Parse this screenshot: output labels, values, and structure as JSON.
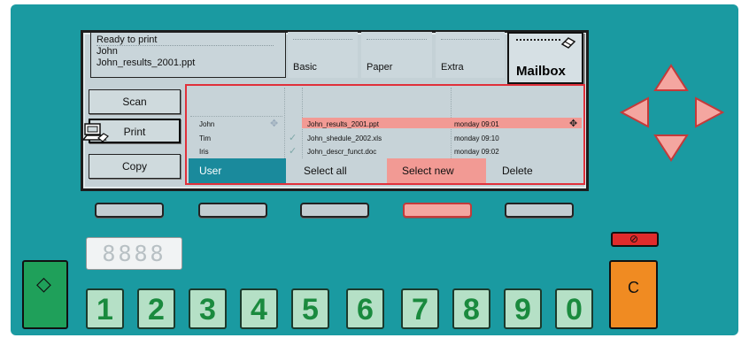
{
  "status": {
    "line1": "Ready to print",
    "line2": "John",
    "line3": "John_results_2001.ppt"
  },
  "tabs": [
    {
      "label": "Basic"
    },
    {
      "label": "Paper"
    },
    {
      "label": "Extra"
    }
  ],
  "mailbox": {
    "label": "Mailbox"
  },
  "side_buttons": {
    "scan": "Scan",
    "print": "Print",
    "copy": "Copy"
  },
  "list": {
    "users": [
      "John",
      "Tim",
      "Iris"
    ],
    "files": [
      "John_results_2001.ppt",
      "John_shedule_2002.xls",
      "John_descr_funct.doc"
    ],
    "times": [
      "monday 09:01",
      "monday 09:10",
      "monday 09:02"
    ]
  },
  "list_buttons": {
    "user": "User",
    "select_all": "Select all",
    "select_new": "Select new",
    "delete": "Delete"
  },
  "display": {
    "value": "8888"
  },
  "keypad": [
    "1",
    "2",
    "3",
    "4",
    "5",
    "6",
    "7",
    "8",
    "9",
    "0"
  ],
  "clear": {
    "label": "C"
  },
  "colors": {
    "panel": "#1a9aa1",
    "accent_red": "#e0303a",
    "start_green": "#1fa05a",
    "clear_orange": "#f08b22"
  }
}
